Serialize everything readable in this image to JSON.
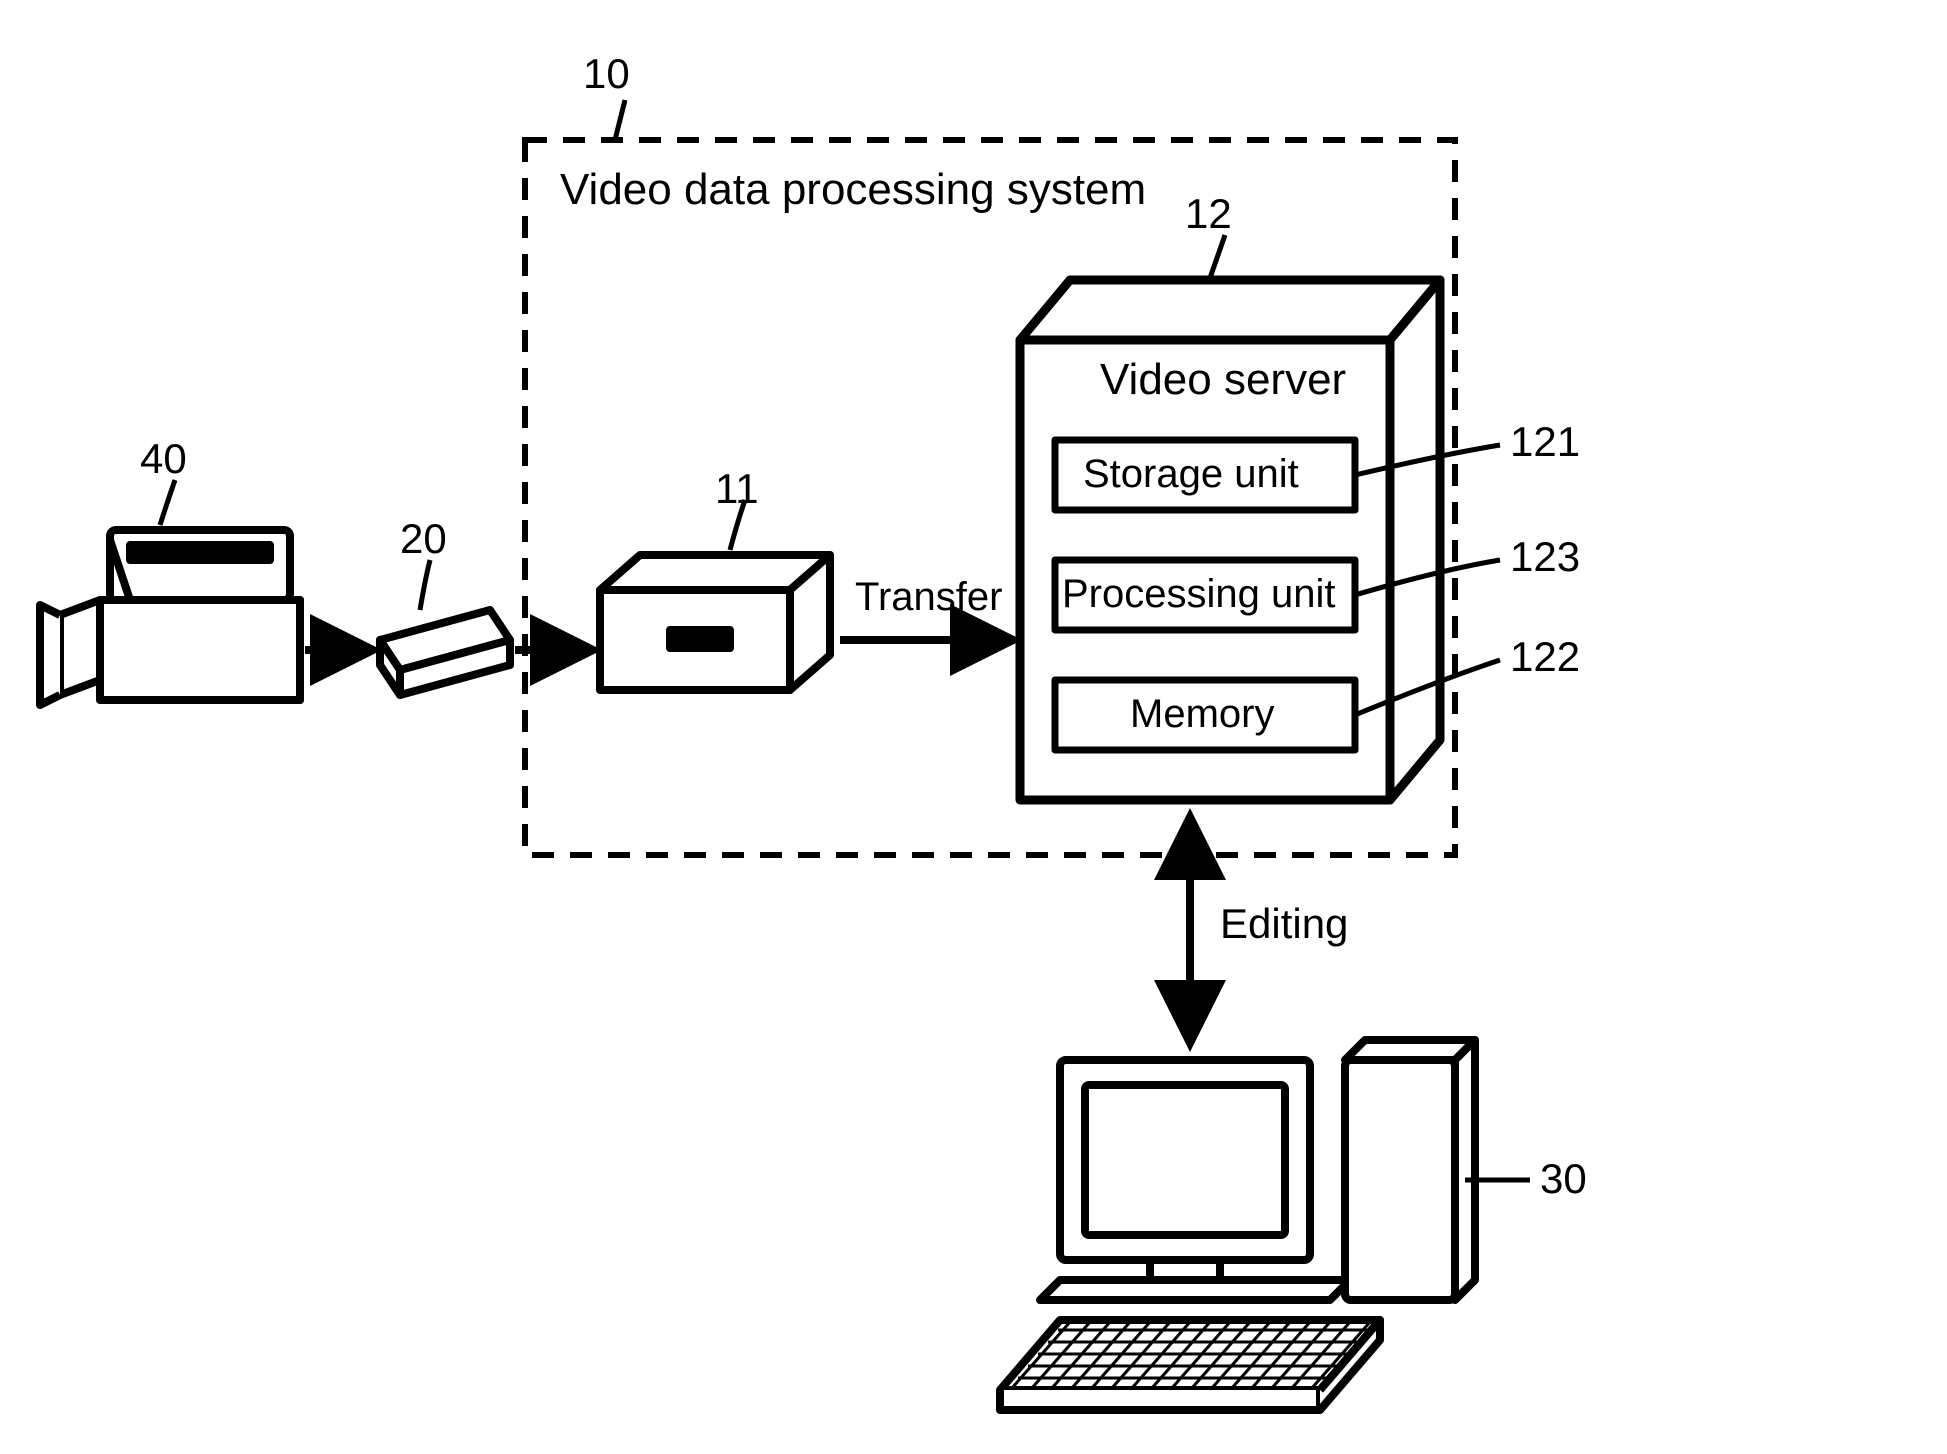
{
  "refs": {
    "system": "10",
    "reader": "11",
    "server": "12",
    "storage": "121",
    "memory": "122",
    "processing": "123",
    "media": "20",
    "pc": "30",
    "camera": "40"
  },
  "labels": {
    "system_title": "Video data processing system",
    "server_title": "Video server",
    "storage_unit": "Storage unit",
    "processing_unit": "Processing unit",
    "memory": "Memory",
    "transfer": "Transfer",
    "editing": "Editing"
  }
}
